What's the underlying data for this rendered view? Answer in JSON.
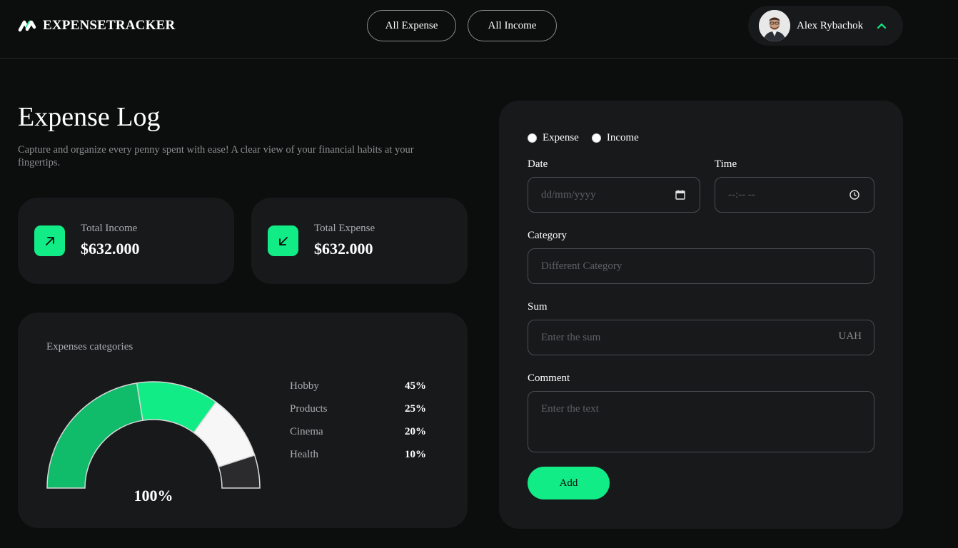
{
  "app": {
    "name": "EXPENSETRACKER"
  },
  "nav": {
    "all_expense": "All Expense",
    "all_income": "All Income"
  },
  "user": {
    "name": "Alex Rybachok"
  },
  "page": {
    "title": "Expense Log",
    "subtitle": "Capture and organize every penny spent with ease! A clear view of your financial habits at your fingertips."
  },
  "stats": {
    "income": {
      "label": "Total Income",
      "value": "$632.000",
      "icon": "arrow-up-right-icon"
    },
    "expense": {
      "label": "Total Expense",
      "value": "$632.000",
      "icon": "arrow-down-left-icon"
    }
  },
  "colors": {
    "accent": "#12ec86",
    "background": "#0c0d0d",
    "card": "#18191b"
  },
  "categories_card": {
    "title": "Expenses categories",
    "total_label": "100%"
  },
  "chart_data": {
    "type": "pie",
    "variant": "semicircle-gauge",
    "categories": [
      "Hobby",
      "Products",
      "Cinema",
      "Health"
    ],
    "values": [
      45,
      25,
      20,
      10
    ],
    "value_labels": [
      "45%",
      "25%",
      "20%",
      "10%"
    ],
    "colors": [
      "#10bb69",
      "#12ec86",
      "#f7f7f7",
      "#2b2b2e"
    ],
    "total": "100%"
  },
  "form": {
    "type_options": [
      "Expense",
      "Income"
    ],
    "date": {
      "label": "Date",
      "placeholder": "dd/mm/yyyy",
      "icon": "calendar-icon"
    },
    "time": {
      "label": "Time",
      "placeholder": "--:-- --",
      "icon": "clock-icon"
    },
    "category": {
      "label": "Category",
      "placeholder": "Different Category"
    },
    "sum": {
      "label": "Sum",
      "placeholder": "Enter the sum",
      "unit": "UAH"
    },
    "comment": {
      "label": "Comment",
      "placeholder": "Enter the text"
    },
    "submit_label": "Add"
  }
}
